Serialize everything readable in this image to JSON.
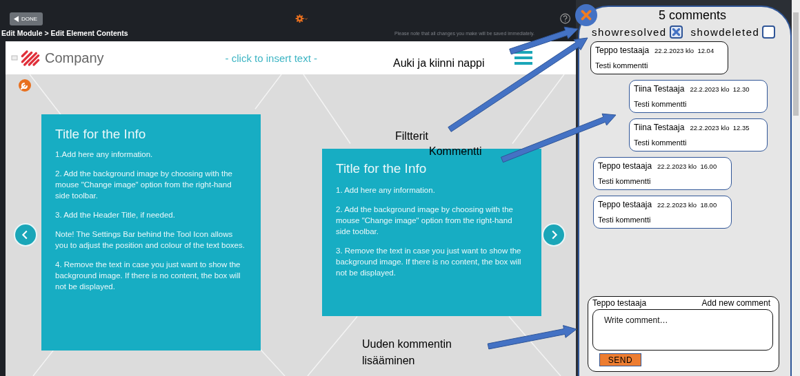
{
  "toolbar": {
    "done_label": "DONE",
    "breadcrumb": "Edit Module > Edit Element Contents",
    "notice": "Please note that all changes you make will be saved immediately."
  },
  "page_header": {
    "logo_text": "Company",
    "insert_text": "- click to insert text -"
  },
  "cards": [
    {
      "title": "Title for the Info",
      "paragraphs": [
        "1.Add here any information.",
        "2. Add the background image by choosing with the mouse \"Change image\" option from the right-hand side toolbar.",
        "3. Add the Header Title, if needed.",
        "Note! The Settings Bar behind the Tool Icon allows you to adjust the position and colour of the text boxes.",
        "4. Remove the text in case you just want to show the background image. If there is no content, the box will not be displayed."
      ]
    },
    {
      "title": "Title for the Info",
      "paragraphs": [
        "1. Add here any information.",
        "2. Add the background image by choosing with the mouse \"Change image\" option from the right-hand side toolbar.",
        "3. Remove the text in case you just want to show the background image. If there is no content, the box will not be displayed."
      ]
    }
  ],
  "comments_panel": {
    "count_label": "5 comments",
    "filters": [
      {
        "label": "showresolved",
        "checked": true
      },
      {
        "label": "showdeleted",
        "checked": false
      }
    ],
    "comments": [
      {
        "kind": "comment",
        "selected": true,
        "author": "Teppo testaaja",
        "timestamp": "22.2.2023 klo  12.04",
        "text": "Testi kommentti"
      },
      {
        "kind": "reply",
        "selected": false,
        "author": "Tiina Testaaja",
        "timestamp": "22.2.2023 klo  12.30",
        "text": "Testi kommentti"
      },
      {
        "kind": "reply",
        "selected": false,
        "author": "Tiina Testaaja",
        "timestamp": "22.2.2023 klo  12.35",
        "text": "Testi kommentti"
      },
      {
        "kind": "comment",
        "selected": false,
        "author": "Teppo testaaja",
        "timestamp": "22.2.2023 klo  16.00",
        "text": "Testi kommentti"
      },
      {
        "kind": "comment",
        "selected": false,
        "author": "Teppo testaaja",
        "timestamp": "22.2.2023 klo  18.00",
        "text": "Testi kommentti"
      }
    ],
    "composer": {
      "author": "Teppo testaaja",
      "heading": "Add new comment",
      "placeholder": "Write comment…",
      "send_label": "SEND"
    }
  },
  "annotations": [
    {
      "text": "Auki ja kiinni nappi"
    },
    {
      "text": "Filtterit"
    },
    {
      "text": "Kommentti"
    },
    {
      "text": "Uuden kommentin lisääminen"
    }
  ]
}
